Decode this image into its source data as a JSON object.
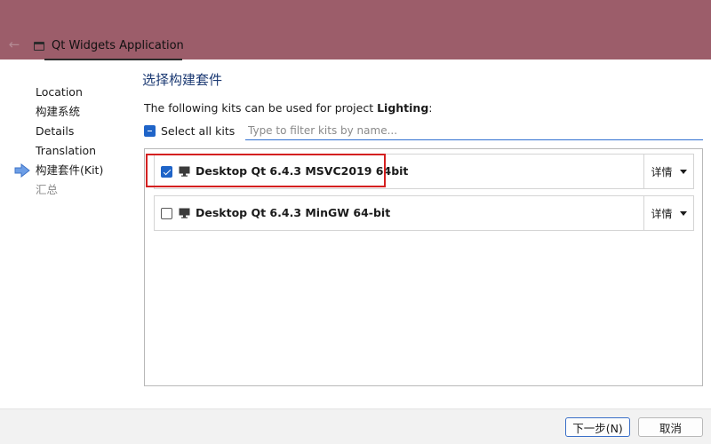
{
  "window": {
    "title": "Qt Widgets Application"
  },
  "sidebar": {
    "steps": [
      {
        "label": "Location"
      },
      {
        "label": "构建系统"
      },
      {
        "label": "Details"
      },
      {
        "label": "Translation"
      },
      {
        "label": "构建套件(Kit)"
      },
      {
        "label": "汇总"
      }
    ],
    "current_step_index": 4
  },
  "main": {
    "page_title": "选择构建套件",
    "description_prefix": "The following kits can be used for project ",
    "project_name": "Lighting",
    "description_suffix": ":",
    "select_all_label": "Select all kits",
    "select_all_state": "partial",
    "filter_placeholder": "Type to filter kits by name...",
    "kits": [
      {
        "name": "Desktop Qt 6.4.3 MSVC2019 64bit",
        "checked": true,
        "details_label": "详情",
        "highlighted": true
      },
      {
        "name": "Desktop Qt 6.4.3 MinGW 64-bit",
        "checked": false,
        "details_label": "详情",
        "highlighted": false
      }
    ]
  },
  "footer": {
    "next_label": "下一步(N)",
    "cancel_label": "取消"
  },
  "colors": {
    "titlebar": "#9c5d6a",
    "accent": "#1f64c8",
    "highlight_border": "#d42020",
    "title_text": "#1c3a73"
  }
}
